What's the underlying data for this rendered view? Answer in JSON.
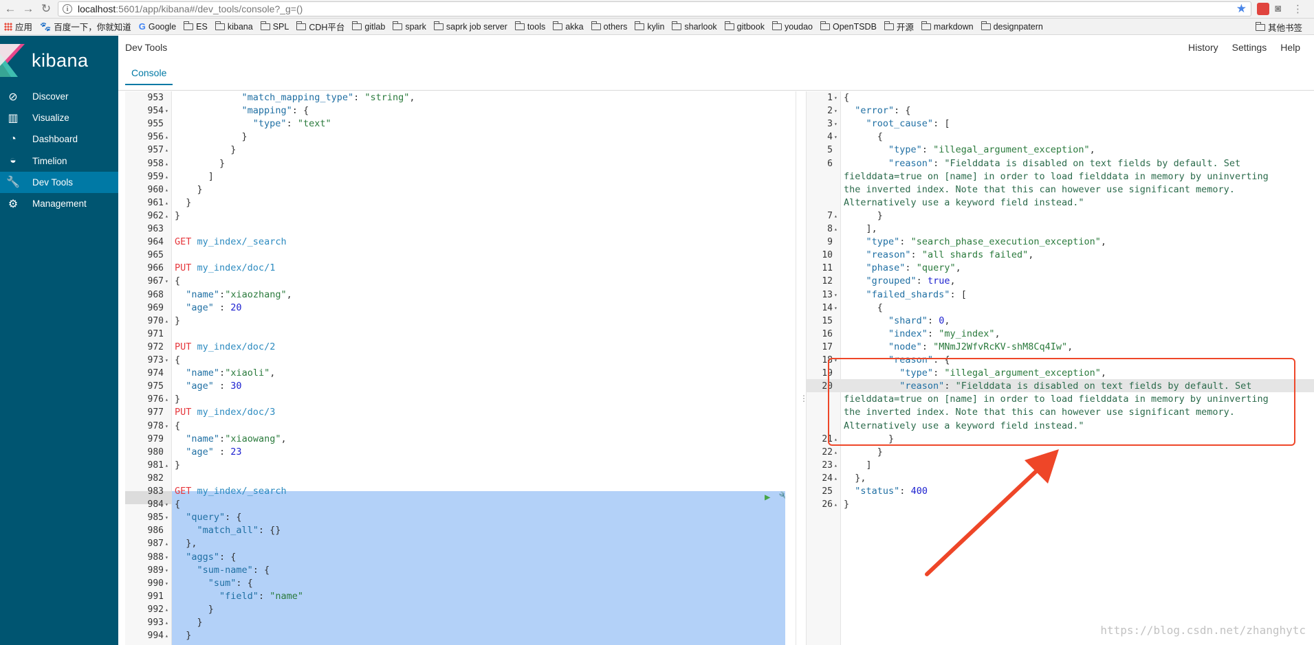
{
  "browser": {
    "url_host": "localhost",
    "url_rest": ":5601/app/kibana#/dev_tools/console?_g=()",
    "bookmarks": [
      "应用",
      "百度一下，你就知道",
      "Google",
      "ES",
      "kibana",
      "SPL",
      "CDH平台",
      "gitlab",
      "spark",
      "saprk job server",
      "tools",
      "akka",
      "others",
      "kylin",
      "sharlook",
      "gitbook",
      "youdao",
      "OpenTSDB",
      "开源",
      "markdown",
      "designpatern"
    ],
    "bookmarks_right": "其他书签"
  },
  "sidebar": {
    "brand": "kibana",
    "items": [
      {
        "label": "Discover",
        "icon": "compass-icon"
      },
      {
        "label": "Visualize",
        "icon": "bar-chart-icon"
      },
      {
        "label": "Dashboard",
        "icon": "dashboard-gauge-icon"
      },
      {
        "label": "Timelion",
        "icon": "timelion-mask-icon"
      },
      {
        "label": "Dev Tools",
        "icon": "wrench-icon"
      },
      {
        "label": "Management",
        "icon": "gear-icon"
      }
    ],
    "active": "Dev Tools"
  },
  "header": {
    "title": "Dev Tools",
    "menu": [
      "History",
      "Settings",
      "Help"
    ],
    "tab": "Console"
  },
  "left_editor": {
    "lines": [
      {
        "n": "953",
        "f": "",
        "t": [
          [
            "k-p",
            "            "
          ],
          [
            "k-key",
            "\"match_mapping_type\""
          ],
          [
            "k-p",
            ": "
          ],
          [
            "k-str",
            "\"string\""
          ],
          [
            "k-p",
            ","
          ]
        ]
      },
      {
        "n": "954",
        "f": "▾",
        "t": [
          [
            "k-p",
            "            "
          ],
          [
            "k-key",
            "\"mapping\""
          ],
          [
            "k-p",
            ": {"
          ]
        ]
      },
      {
        "n": "955",
        "f": "",
        "t": [
          [
            "k-p",
            "              "
          ],
          [
            "k-key",
            "\"type\""
          ],
          [
            "k-p",
            ": "
          ],
          [
            "k-str",
            "\"text\""
          ]
        ]
      },
      {
        "n": "956",
        "f": "▴",
        "t": [
          [
            "k-p",
            "            }"
          ]
        ]
      },
      {
        "n": "957",
        "f": "▴",
        "t": [
          [
            "k-p",
            "          }"
          ]
        ]
      },
      {
        "n": "958",
        "f": "▴",
        "t": [
          [
            "k-p",
            "        }"
          ]
        ]
      },
      {
        "n": "959",
        "f": "▴",
        "t": [
          [
            "k-p",
            "      ]"
          ]
        ]
      },
      {
        "n": "960",
        "f": "▴",
        "t": [
          [
            "k-p",
            "    }"
          ]
        ]
      },
      {
        "n": "961",
        "f": "▴",
        "t": [
          [
            "k-p",
            "  }"
          ]
        ]
      },
      {
        "n": "962",
        "f": "▴",
        "t": [
          [
            "k-p",
            "}"
          ]
        ]
      },
      {
        "n": "963",
        "f": "",
        "t": []
      },
      {
        "n": "964",
        "f": "",
        "t": [
          [
            "k-method",
            "GET"
          ],
          [
            "k-p",
            " "
          ],
          [
            "k-url",
            "my_index/_search"
          ]
        ]
      },
      {
        "n": "965",
        "f": "",
        "t": []
      },
      {
        "n": "966",
        "f": "",
        "t": [
          [
            "k-method",
            "PUT"
          ],
          [
            "k-p",
            " "
          ],
          [
            "k-url",
            "my_index/doc/1"
          ]
        ]
      },
      {
        "n": "967",
        "f": "▾",
        "t": [
          [
            "k-p",
            "{"
          ]
        ]
      },
      {
        "n": "968",
        "f": "",
        "t": [
          [
            "k-p",
            "  "
          ],
          [
            "k-key",
            "\"name\""
          ],
          [
            "k-p",
            ":"
          ],
          [
            "k-str",
            "\"xiaozhang\""
          ],
          [
            "k-p",
            ","
          ]
        ]
      },
      {
        "n": "969",
        "f": "",
        "t": [
          [
            "k-p",
            "  "
          ],
          [
            "k-key",
            "\"age\""
          ],
          [
            "k-p",
            " : "
          ],
          [
            "k-num",
            "20"
          ]
        ]
      },
      {
        "n": "970",
        "f": "▴",
        "t": [
          [
            "k-p",
            "}"
          ]
        ]
      },
      {
        "n": "971",
        "f": "",
        "t": []
      },
      {
        "n": "972",
        "f": "",
        "t": [
          [
            "k-method",
            "PUT"
          ],
          [
            "k-p",
            " "
          ],
          [
            "k-url",
            "my_index/doc/2"
          ]
        ]
      },
      {
        "n": "973",
        "f": "▾",
        "t": [
          [
            "k-p",
            "{"
          ]
        ]
      },
      {
        "n": "974",
        "f": "",
        "t": [
          [
            "k-p",
            "  "
          ],
          [
            "k-key",
            "\"name\""
          ],
          [
            "k-p",
            ":"
          ],
          [
            "k-str",
            "\"xiaoli\""
          ],
          [
            "k-p",
            ","
          ]
        ]
      },
      {
        "n": "975",
        "f": "",
        "t": [
          [
            "k-p",
            "  "
          ],
          [
            "k-key",
            "\"age\""
          ],
          [
            "k-p",
            " : "
          ],
          [
            "k-num",
            "30"
          ]
        ]
      },
      {
        "n": "976",
        "f": "▴",
        "t": [
          [
            "k-p",
            "}"
          ]
        ]
      },
      {
        "n": "977",
        "f": "",
        "t": [
          [
            "k-method",
            "PUT"
          ],
          [
            "k-p",
            " "
          ],
          [
            "k-url",
            "my_index/doc/3"
          ]
        ]
      },
      {
        "n": "978",
        "f": "▾",
        "t": [
          [
            "k-p",
            "{"
          ]
        ]
      },
      {
        "n": "979",
        "f": "",
        "t": [
          [
            "k-p",
            "  "
          ],
          [
            "k-key",
            "\"name\""
          ],
          [
            "k-p",
            ":"
          ],
          [
            "k-str",
            "\"xiaowang\""
          ],
          [
            "k-p",
            ","
          ]
        ]
      },
      {
        "n": "980",
        "f": "",
        "t": [
          [
            "k-p",
            "  "
          ],
          [
            "k-key",
            "\"age\""
          ],
          [
            "k-p",
            " : "
          ],
          [
            "k-num",
            "23"
          ]
        ]
      },
      {
        "n": "981",
        "f": "▴",
        "t": [
          [
            "k-p",
            "}"
          ]
        ]
      },
      {
        "n": "982",
        "f": "",
        "t": []
      },
      {
        "n": "983",
        "f": "",
        "t": [
          [
            "k-method",
            "GET"
          ],
          [
            "k-p",
            " "
          ],
          [
            "k-url",
            "my_index/_search"
          ]
        ]
      },
      {
        "n": "984",
        "f": "▾",
        "t": [
          [
            "k-p",
            "{"
          ]
        ]
      },
      {
        "n": "985",
        "f": "▾",
        "t": [
          [
            "k-p",
            "  "
          ],
          [
            "k-key",
            "\"query\""
          ],
          [
            "k-p",
            ": {"
          ]
        ]
      },
      {
        "n": "986",
        "f": "",
        "t": [
          [
            "k-p",
            "    "
          ],
          [
            "k-key",
            "\"match_all\""
          ],
          [
            "k-p",
            ": {}"
          ]
        ]
      },
      {
        "n": "987",
        "f": "▴",
        "t": [
          [
            "k-p",
            "  },"
          ]
        ]
      },
      {
        "n": "988",
        "f": "▾",
        "t": [
          [
            "k-p",
            "  "
          ],
          [
            "k-key",
            "\"aggs\""
          ],
          [
            "k-p",
            ": {"
          ]
        ]
      },
      {
        "n": "989",
        "f": "▾",
        "t": [
          [
            "k-p",
            "    "
          ],
          [
            "k-key",
            "\"sum-name\""
          ],
          [
            "k-p",
            ": {"
          ]
        ]
      },
      {
        "n": "990",
        "f": "▾",
        "t": [
          [
            "k-p",
            "      "
          ],
          [
            "k-key",
            "\"sum\""
          ],
          [
            "k-p",
            ": {"
          ]
        ]
      },
      {
        "n": "991",
        "f": "",
        "t": [
          [
            "k-p",
            "        "
          ],
          [
            "k-key",
            "\"field\""
          ],
          [
            "k-p",
            ": "
          ],
          [
            "k-str",
            "\"name\""
          ]
        ]
      },
      {
        "n": "992",
        "f": "▴",
        "t": [
          [
            "k-p",
            "      }"
          ]
        ]
      },
      {
        "n": "993",
        "f": "▴",
        "t": [
          [
            "k-p",
            "    }"
          ]
        ]
      },
      {
        "n": "994",
        "f": "▴",
        "t": [
          [
            "k-p",
            "  }"
          ]
        ]
      }
    ]
  },
  "right_editor": {
    "lines": [
      {
        "n": "1",
        "f": "▾",
        "t": [
          [
            "k-p",
            "{"
          ]
        ]
      },
      {
        "n": "2",
        "f": "▾",
        "t": [
          [
            "k-p",
            "  "
          ],
          [
            "k-key",
            "\"error\""
          ],
          [
            "k-p",
            ": {"
          ]
        ]
      },
      {
        "n": "3",
        "f": "▾",
        "t": [
          [
            "k-p",
            "    "
          ],
          [
            "k-key",
            "\"root_cause\""
          ],
          [
            "k-p",
            ": ["
          ]
        ]
      },
      {
        "n": "4",
        "f": "▾",
        "t": [
          [
            "k-p",
            "      {"
          ]
        ]
      },
      {
        "n": "5",
        "f": "",
        "t": [
          [
            "k-p",
            "        "
          ],
          [
            "k-key",
            "\"type\""
          ],
          [
            "k-p",
            ": "
          ],
          [
            "k-str",
            "\"illegal_argument_exception\""
          ],
          [
            "k-p",
            ","
          ]
        ]
      },
      {
        "n": "6",
        "f": "",
        "t": [
          [
            "k-p",
            "        "
          ],
          [
            "k-key",
            "\"reason\""
          ],
          [
            "k-p",
            ": "
          ],
          [
            "k-txt",
            "\"Fielddata is disabled on text fields by default. Set"
          ]
        ]
      },
      {
        "n": "",
        "f": "",
        "t": [
          [
            "k-txt",
            "fielddata=true on [name] in order to load fielddata in memory by uninverting"
          ]
        ]
      },
      {
        "n": "",
        "f": "",
        "t": [
          [
            "k-txt",
            "the inverted index. Note that this can however use significant memory."
          ]
        ]
      },
      {
        "n": "",
        "f": "",
        "t": [
          [
            "k-txt",
            "Alternatively use a keyword field instead.\""
          ]
        ]
      },
      {
        "n": "7",
        "f": "▴",
        "t": [
          [
            "k-p",
            "      }"
          ]
        ]
      },
      {
        "n": "8",
        "f": "▴",
        "t": [
          [
            "k-p",
            "    ],"
          ]
        ]
      },
      {
        "n": "9",
        "f": "",
        "t": [
          [
            "k-p",
            "    "
          ],
          [
            "k-key",
            "\"type\""
          ],
          [
            "k-p",
            ": "
          ],
          [
            "k-str",
            "\"search_phase_execution_exception\""
          ],
          [
            "k-p",
            ","
          ]
        ]
      },
      {
        "n": "10",
        "f": "",
        "t": [
          [
            "k-p",
            "    "
          ],
          [
            "k-key",
            "\"reason\""
          ],
          [
            "k-p",
            ": "
          ],
          [
            "k-str",
            "\"all shards failed\""
          ],
          [
            "k-p",
            ","
          ]
        ]
      },
      {
        "n": "11",
        "f": "",
        "t": [
          [
            "k-p",
            "    "
          ],
          [
            "k-key",
            "\"phase\""
          ],
          [
            "k-p",
            ": "
          ],
          [
            "k-str",
            "\"query\""
          ],
          [
            "k-p",
            ","
          ]
        ]
      },
      {
        "n": "12",
        "f": "",
        "t": [
          [
            "k-p",
            "    "
          ],
          [
            "k-key",
            "\"grouped\""
          ],
          [
            "k-p",
            ": "
          ],
          [
            "k-bool",
            "true"
          ],
          [
            "k-p",
            ","
          ]
        ]
      },
      {
        "n": "13",
        "f": "▾",
        "t": [
          [
            "k-p",
            "    "
          ],
          [
            "k-key",
            "\"failed_shards\""
          ],
          [
            "k-p",
            ": ["
          ]
        ]
      },
      {
        "n": "14",
        "f": "▾",
        "t": [
          [
            "k-p",
            "      {"
          ]
        ]
      },
      {
        "n": "15",
        "f": "",
        "t": [
          [
            "k-p",
            "        "
          ],
          [
            "k-key",
            "\"shard\""
          ],
          [
            "k-p",
            ": "
          ],
          [
            "k-num",
            "0"
          ],
          [
            "k-p",
            ","
          ]
        ]
      },
      {
        "n": "16",
        "f": "",
        "t": [
          [
            "k-p",
            "        "
          ],
          [
            "k-key",
            "\"index\""
          ],
          [
            "k-p",
            ": "
          ],
          [
            "k-str",
            "\"my_index\""
          ],
          [
            "k-p",
            ","
          ]
        ]
      },
      {
        "n": "17",
        "f": "",
        "t": [
          [
            "k-p",
            "        "
          ],
          [
            "k-key",
            "\"node\""
          ],
          [
            "k-p",
            ": "
          ],
          [
            "k-str",
            "\"MNmJ2WfvRcKV-shM8Cq4Iw\""
          ],
          [
            "k-p",
            ","
          ]
        ]
      },
      {
        "n": "18",
        "f": "▾",
        "t": [
          [
            "k-p",
            "        "
          ],
          [
            "k-key",
            "\"reason\""
          ],
          [
            "k-p",
            ": {"
          ]
        ]
      },
      {
        "n": "19",
        "f": "",
        "t": [
          [
            "k-p",
            "          "
          ],
          [
            "k-key",
            "\"type\""
          ],
          [
            "k-p",
            ": "
          ],
          [
            "k-str",
            "\"illegal_argument_exception\""
          ],
          [
            "k-p",
            ","
          ]
        ]
      },
      {
        "n": "20",
        "f": "",
        "t": [
          [
            "k-p",
            "          "
          ],
          [
            "k-key",
            "\"reason\""
          ],
          [
            "k-p",
            ": "
          ],
          [
            "k-txt",
            "\"Fielddata is disabled on text fields by default. Set"
          ]
        ]
      },
      {
        "n": "",
        "f": "",
        "t": [
          [
            "k-txt",
            "fielddata=true on [name] in order to load fielddata in memory by uninverting"
          ]
        ]
      },
      {
        "n": "",
        "f": "",
        "t": [
          [
            "k-txt",
            "the inverted index. Note that this can however use significant memory."
          ]
        ]
      },
      {
        "n": "",
        "f": "",
        "t": [
          [
            "k-txt",
            "Alternatively use a keyword field instead.\""
          ]
        ]
      },
      {
        "n": "21",
        "f": "▴",
        "t": [
          [
            "k-p",
            "        }"
          ]
        ]
      },
      {
        "n": "22",
        "f": "▴",
        "t": [
          [
            "k-p",
            "      }"
          ]
        ]
      },
      {
        "n": "23",
        "f": "▴",
        "t": [
          [
            "k-p",
            "    ]"
          ]
        ]
      },
      {
        "n": "24",
        "f": "▴",
        "t": [
          [
            "k-p",
            "  },"
          ]
        ]
      },
      {
        "n": "25",
        "f": "",
        "t": [
          [
            "k-p",
            "  "
          ],
          [
            "k-key",
            "\"status\""
          ],
          [
            "k-p",
            ": "
          ],
          [
            "k-num",
            "400"
          ]
        ]
      },
      {
        "n": "26",
        "f": "▴",
        "t": [
          [
            "k-p",
            "}"
          ]
        ]
      }
    ]
  },
  "watermark": "https://blog.csdn.net/zhanghytc"
}
